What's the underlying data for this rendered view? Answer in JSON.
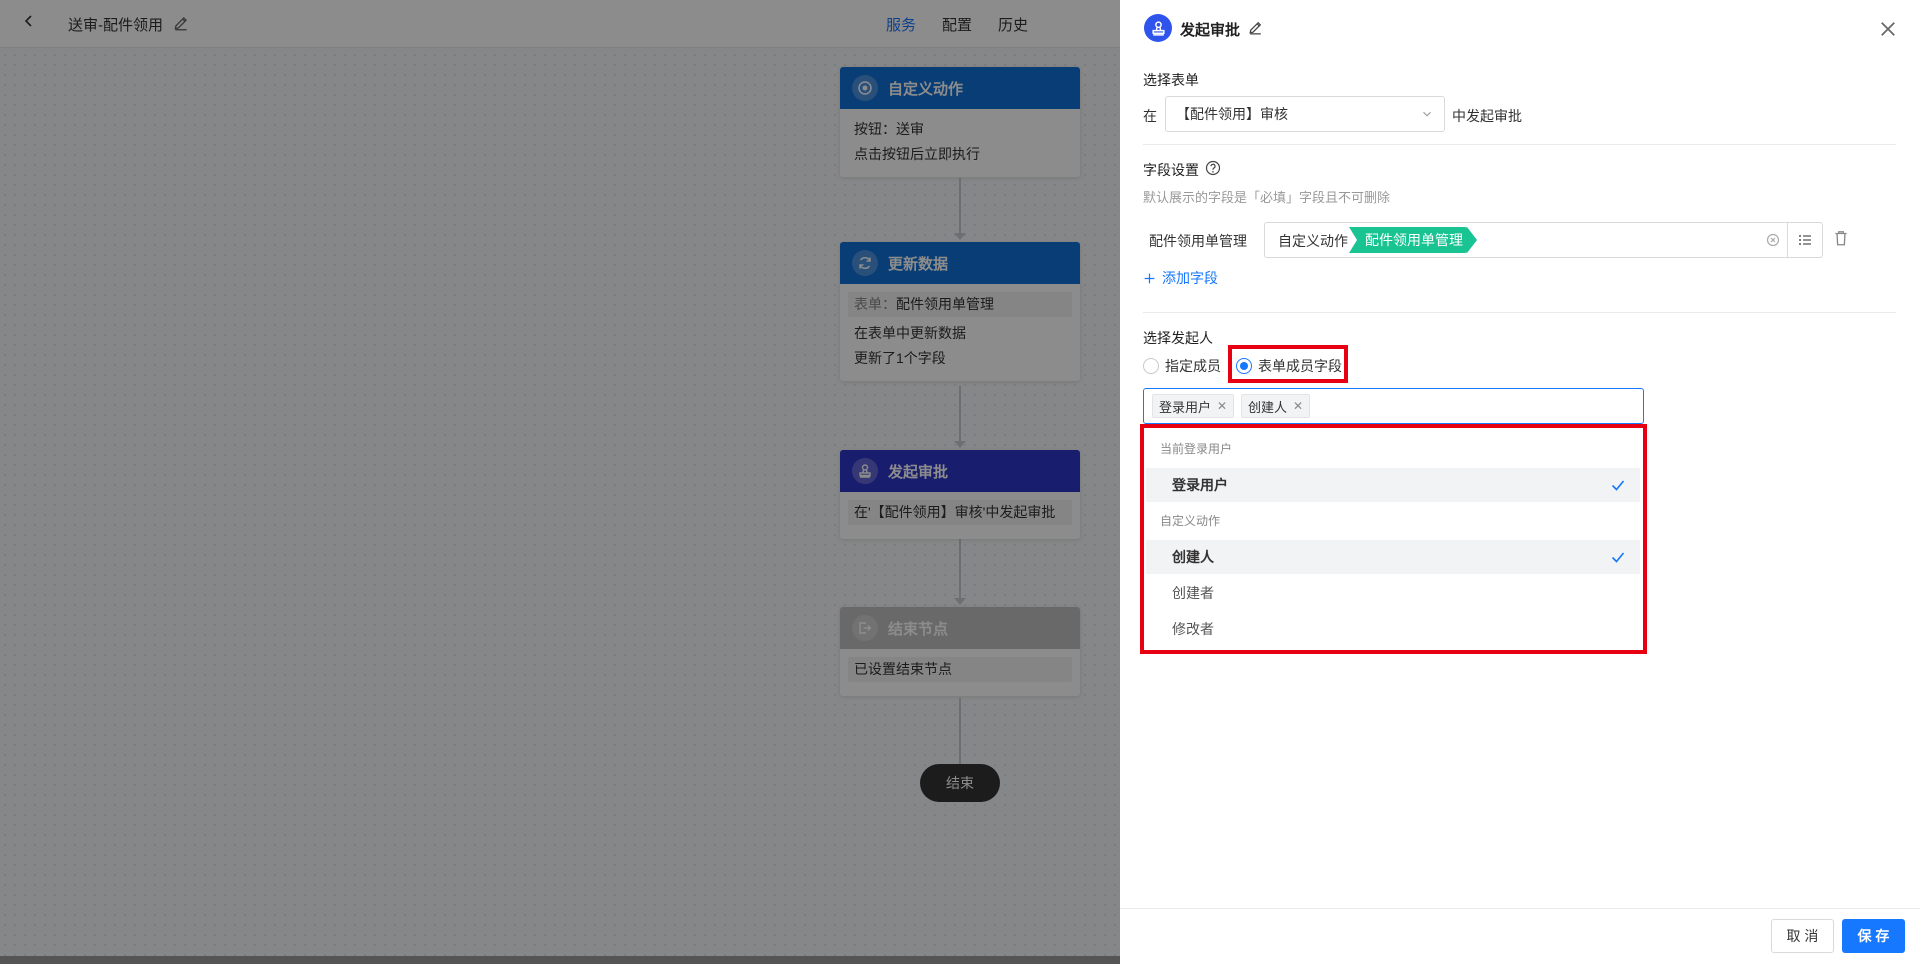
{
  "topbar": {
    "back_icon": "chevron-left-icon",
    "app_title": "送审-配件领用",
    "tabs": [
      {
        "label": "服务",
        "active": true
      },
      {
        "label": "配置",
        "active": false
      },
      {
        "label": "历史",
        "active": false
      }
    ]
  },
  "flow": {
    "nodes": [
      {
        "title": "自定义动作",
        "color": "#0f6fd6",
        "icon": "target-icon",
        "lines": [
          "按钮：送审",
          "点击按钮后立即执行"
        ]
      },
      {
        "title": "更新数据",
        "color": "#0f6fd6",
        "icon": "refresh-icon",
        "pill_label": "表单：",
        "pill_value": "配件领用单管理",
        "lines": [
          "在表单中更新数据",
          "更新了1个字段"
        ]
      },
      {
        "title": "发起审批",
        "color": "#2f35c8",
        "icon": "stamp-icon",
        "pill_text": "在'【配件领用】审核'中发起审批"
      },
      {
        "title": "结束节点",
        "color": "#bfbfbf",
        "icon": "exit-icon",
        "pill_text": "已设置结束节点"
      }
    ],
    "end_label": "结束"
  },
  "drawer": {
    "title": "发起审批",
    "header_icon": "stamp-icon",
    "select_form": {
      "label": "选择表单",
      "prefix": "在",
      "value": "【配件领用】审核",
      "suffix": "中发起审批"
    },
    "field_settings": {
      "label": "字段设置",
      "hint": "默认展示的字段是「必填」字段且不可删除",
      "row_label": "配件领用单管理",
      "crumb_source": "自定义动作",
      "crumb_field": "配件领用单管理",
      "add_label": "添加字段"
    },
    "initiator": {
      "label": "选择发起人",
      "options": [
        {
          "label": "指定成员",
          "checked": false
        },
        {
          "label": "表单成员字段",
          "checked": true
        }
      ],
      "selected_tags": [
        "登录用户",
        "创建人"
      ]
    },
    "dropdown": {
      "groups": [
        {
          "label": "当前登录用户",
          "items": [
            {
              "label": "登录用户",
              "selected": true
            }
          ]
        },
        {
          "label": "自定义动作",
          "items": [
            {
              "label": "创建人",
              "selected": true
            },
            {
              "label": "创建者",
              "selected": false
            },
            {
              "label": "修改者",
              "selected": false
            }
          ]
        }
      ]
    },
    "footer": {
      "cancel_label": "取 消",
      "save_label": "保 存"
    }
  },
  "colors": {
    "accent": "#1677ff",
    "highlight_border": "#e60012",
    "field_tag": "#19c392"
  }
}
